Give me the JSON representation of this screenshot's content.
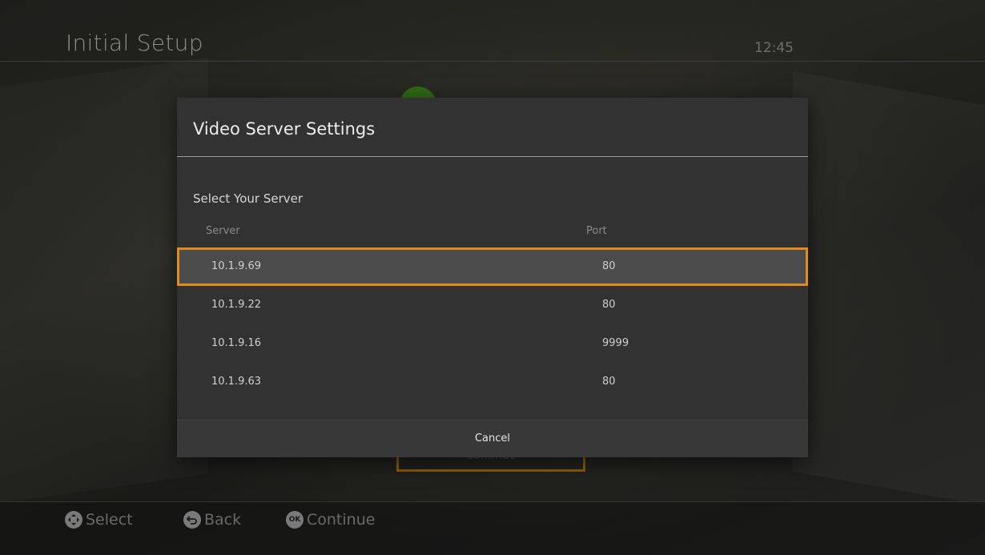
{
  "header": {
    "title": "Initial Setup",
    "clock": "12:45"
  },
  "background": {
    "continue_label": "Continue"
  },
  "dialog": {
    "title": "Video Server Settings",
    "subtitle": "Select Your Server",
    "columns": {
      "server": "Server",
      "port": "Port"
    },
    "rows": [
      {
        "server": "10.1.9.69",
        "port": "80",
        "selected": true
      },
      {
        "server": "10.1.9.22",
        "port": "80",
        "selected": false
      },
      {
        "server": "10.1.9.16",
        "port": "9999",
        "selected": false
      },
      {
        "server": "10.1.9.63",
        "port": "80",
        "selected": false
      }
    ],
    "cancel_label": "Cancel"
  },
  "footer": {
    "hints": [
      {
        "icon": "dpad-icon",
        "label": "Select"
      },
      {
        "icon": "back-icon",
        "label": "Back"
      },
      {
        "icon": "ok-icon",
        "icon_text": "OK",
        "label": "Continue"
      }
    ]
  },
  "colors": {
    "accent": "#e08d1e",
    "dialog_bg": "#323232",
    "avatar": "#2f6a16"
  }
}
